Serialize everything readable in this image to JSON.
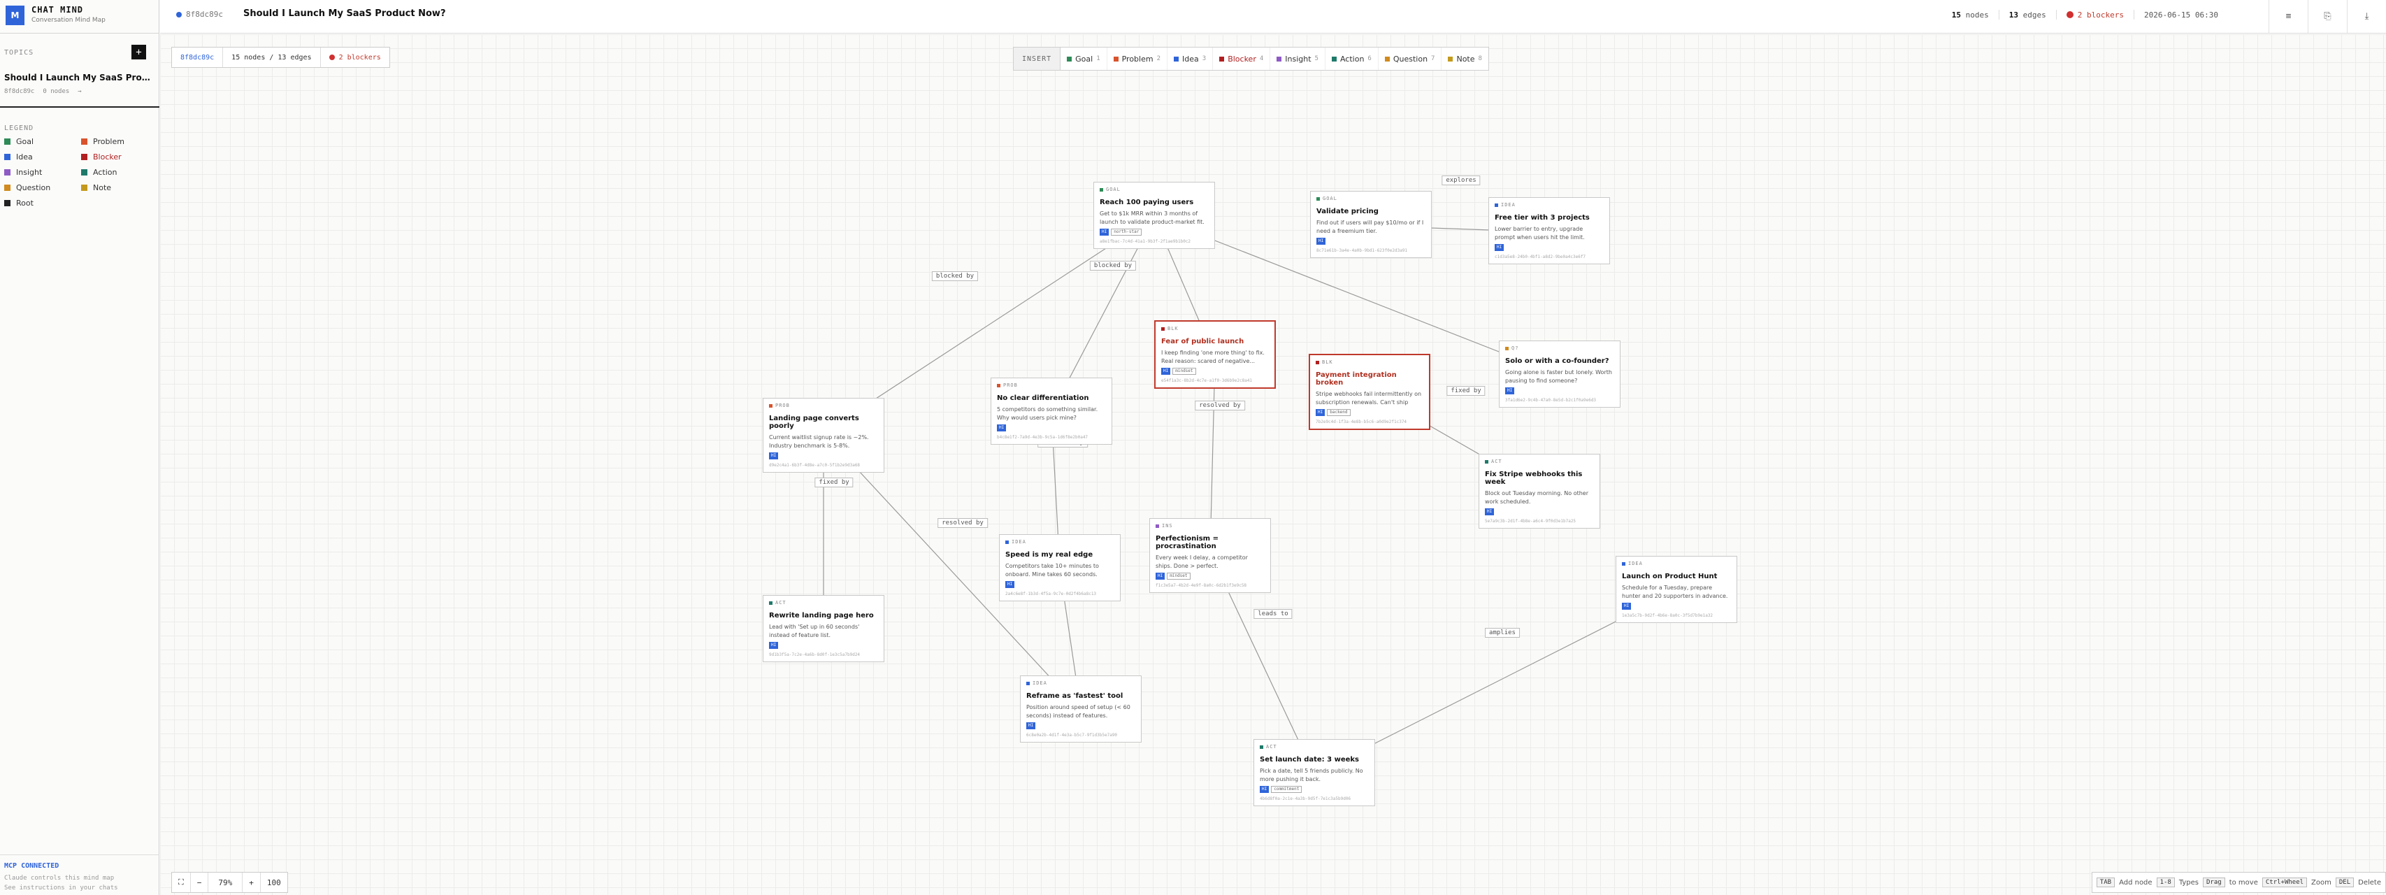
{
  "app": {
    "logo_letter": "M",
    "title": "CHAT MIND",
    "subtitle": "Conversation Mind Map"
  },
  "sidebar": {
    "topics_label": "TOPICS",
    "add_label": "+",
    "topic": {
      "title": "Should I Launch My SaaS Produ...",
      "id": "8f8dc89c",
      "nodes": "0 nodes",
      "arrow": "→"
    },
    "legend_label": "LEGEND",
    "legend": [
      {
        "label": "Goal",
        "color": "#2e8b57"
      },
      {
        "label": "Problem",
        "color": "#d9532c"
      },
      {
        "label": "Idea",
        "color": "#2f64d9"
      },
      {
        "label": "Blocker",
        "color": "#b02020"
      },
      {
        "label": "Insight",
        "color": "#8e5bc4"
      },
      {
        "label": "Action",
        "color": "#1f7a6a"
      },
      {
        "label": "Question",
        "color": "#d08a1e"
      },
      {
        "label": "Note",
        "color": "#c49a1e"
      },
      {
        "label": "Root",
        "color": "#222222"
      }
    ],
    "mcp_status": "MCP CONNECTED",
    "mcp_line1": "Claude controls this mind map",
    "mcp_line2": "See instructions in your chats"
  },
  "header": {
    "id": "8f8dc89c",
    "title": "Should I Launch My SaaS Product Now?",
    "nodes_count": "15",
    "nodes_label": "nodes",
    "edges_count": "13",
    "edges_label": "edges",
    "blockers": "2 blockers",
    "timestamp": "2026-06-15 06:30",
    "btn_hide": "≡",
    "btn_save": "⎘",
    "btn_export": "⤓"
  },
  "crumb": {
    "id": "8f8dc89c",
    "stats": "15 nodes / 13 edges",
    "blockers": "2 blockers"
  },
  "insert": {
    "label": "INSERT",
    "items": [
      {
        "label": "Goal",
        "key": "1",
        "color": "#2e8b57"
      },
      {
        "label": "Problem",
        "key": "2",
        "color": "#d9532c"
      },
      {
        "label": "Idea",
        "key": "3",
        "color": "#2f64d9"
      },
      {
        "label": "Blocker",
        "key": "4",
        "color": "#b02020"
      },
      {
        "label": "Insight",
        "key": "5",
        "color": "#8e5bc4"
      },
      {
        "label": "Action",
        "key": "6",
        "color": "#1f7a6a"
      },
      {
        "label": "Question",
        "key": "7",
        "color": "#d08a1e"
      },
      {
        "label": "Note",
        "key": "8",
        "color": "#c49a1e"
      }
    ]
  },
  "nodes": [
    {
      "key": "goal-100",
      "type": "GOAL",
      "color": "#2e8b57",
      "title": "Reach 100 paying users",
      "body": "Get to $1k MRR within 3 months of launch to validate product-market fit.",
      "tags": [
        "HI",
        "north-star"
      ],
      "foot": "a8e1fbac-7c4d-41a1-9b3f-2f1ae9b1b0c2",
      "blocker": false
    },
    {
      "key": "goal-pricing",
      "type": "GOAL",
      "color": "#2e8b57",
      "title": "Validate pricing",
      "body": "Find out if users will pay $10/mo or if I need a freemium tier.",
      "tags": [
        "HI"
      ],
      "foot": "8c71e61b-3a4e-4a0b-9bd1-623f0e2d3a91",
      "blocker": false
    },
    {
      "key": "idea-free",
      "type": "IDEA",
      "color": "#2f64d9",
      "title": "Free tier with 3 projects",
      "body": "Lower barrier to entry, upgrade prompt when users hit the limit.",
      "tags": [
        "HI"
      ],
      "foot": "c1d3a5e8-24b0-4bf1-a8d2-9be0a4c3e6f7",
      "blocker": false
    },
    {
      "key": "blk-fear",
      "type": "BLK",
      "color": "#b02020",
      "title": "Fear of public launch",
      "body": "I keep finding 'one more thing' to fix. Real reason: scared of negative...",
      "tags": [
        "HI",
        "mindset"
      ],
      "foot": "e54f1a3c-8b2d-4c7e-a1f0-3d6b9e2c8a41",
      "blocker": true
    },
    {
      "key": "blk-pay",
      "type": "BLK",
      "color": "#b02020",
      "title": "Payment integration broken",
      "body": "Stripe webhooks fail intermittently on subscription renewals. Can't ship paid...",
      "tags": [
        "HI",
        "backend"
      ],
      "foot": "7b2e9c4d-1f3a-4e8b-b5c6-a0d9e2f1c374",
      "blocker": true
    },
    {
      "key": "q-solo",
      "type": "Q?",
      "color": "#d08a1e",
      "title": "Solo or with a co-founder?",
      "body": "Going alone is faster but lonely. Worth pausing to find someone?",
      "tags": [
        "HI"
      ],
      "foot": "3fa1d6e2-9c4b-47a0-8e5d-b2c1f0a9e6d3",
      "blocker": false
    },
    {
      "key": "prob-landing",
      "type": "PROB",
      "color": "#d9532c",
      "title": "Landing page converts poorly",
      "body": "Current waitlist signup rate is ~2%. Industry benchmark is 5-8%.",
      "tags": [
        "HI"
      ],
      "foot": "d9e2c4a1-6b3f-4d8e-a7c0-5f1b2e9d3a68",
      "blocker": false
    },
    {
      "key": "prob-diff",
      "type": "PROB",
      "color": "#d9532c",
      "title": "No clear differentiation",
      "body": "5 competitors do something similar. Why would users pick mine?",
      "tags": [
        "HI"
      ],
      "foot": "b4c8e1f2-7a9d-4e3b-9c5a-1d6f8e2b0a47",
      "blocker": false
    },
    {
      "key": "act-stripe",
      "type": "ACT",
      "color": "#1f7a6a",
      "title": "Fix Stripe webhooks this week",
      "body": "Block out Tuesday morning. No other work scheduled.",
      "tags": [
        "HI"
      ],
      "foot": "5e7a9c3b-2d1f-4b8e-a6c4-9f0d3e1b7a25",
      "blocker": false
    },
    {
      "key": "ins-perf",
      "type": "INS",
      "color": "#8e5bc4",
      "title": "Perfectionism = procrastination",
      "body": "Every week I delay, a competitor ships. Done > perfect.",
      "tags": [
        "HI",
        "mindset"
      ],
      "foot": "f1c3e5a7-4b2d-4e9f-8a0c-6d2b1f3e9c58",
      "blocker": false
    },
    {
      "key": "idea-speed",
      "type": "IDEA",
      "color": "#2f64d9",
      "title": "Speed is my real edge",
      "body": "Competitors take 10+ minutes to onboard. Mine takes 60 seconds. That...",
      "tags": [
        "HI"
      ],
      "foot": "2a4c6e8f-1b3d-4f5a-9c7e-0d2f4b6a8c13",
      "blocker": false
    },
    {
      "key": "act-rewrite",
      "type": "ACT",
      "color": "#1f7a6a",
      "title": "Rewrite landing page hero",
      "body": "Lead with 'Set up in 60 seconds' instead of feature list.",
      "tags": [
        "HI"
      ],
      "foot": "9d1b3f5a-7c2e-4a6b-8d0f-1e3c5a7b9d24",
      "blocker": false
    },
    {
      "key": "idea-reframe",
      "type": "IDEA",
      "color": "#2f64d9",
      "title": "Reframe as 'fastest' tool",
      "body": "Position around speed of setup (< 60 seconds) instead of features.",
      "tags": [
        "HI"
      ],
      "foot": "6c8e0a2b-4d1f-4e3a-b5c7-9f1d3b5e7a90",
      "blocker": false
    },
    {
      "key": "act-launch",
      "type": "ACT",
      "color": "#1f7a6a",
      "title": "Set launch date: 3 weeks",
      "body": "Pick a date, tell 5 friends publicly. No more pushing it back.",
      "tags": [
        "HI",
        "commitment"
      ],
      "foot": "4b6d8f0a-2c1e-4a3b-9d5f-7e1c3a5b9d06",
      "blocker": false
    },
    {
      "key": "note-ph",
      "type": "IDEA",
      "color": "#2f64d9",
      "title": "Launch on Product Hunt",
      "body": "Schedule for a Tuesday, prepare hunter and 20 supporters in advance.",
      "tags": [
        "HI"
      ],
      "foot": "1e3a5c7b-9d2f-4b6e-8a0c-3f5d7b9e1a32",
      "blocker": false
    }
  ],
  "edge_labels": [
    "explores",
    "blocked by",
    "blocked by",
    "blocked by",
    "depends on",
    "fixed by",
    "fixed by",
    "resolved by",
    "resolved by",
    "resolved by",
    "leads to",
    "leads to",
    "amplies"
  ],
  "zoom": {
    "fit": "⛶",
    "minus": "−",
    "value": "79%",
    "plus": "+",
    "reset": "100"
  },
  "shortcuts": [
    {
      "key": "TAB",
      "label": "Add node"
    },
    {
      "key": "1-8",
      "label": "Types"
    },
    {
      "key": "Drag",
      "label": "to move"
    },
    {
      "key": "Ctrl+Wheel",
      "label": "Zoom"
    },
    {
      "key": "DEL",
      "label": "Delete"
    }
  ]
}
